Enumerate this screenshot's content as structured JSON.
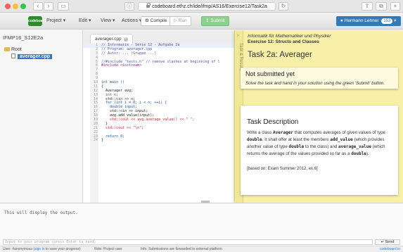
{
  "browser": {
    "url": "codeboard.ethz.ch/ide/ifmp/AS16/Exercise12/Task2a",
    "buttons": {
      "back": "‹",
      "forward": "›",
      "sidebar": "▭",
      "info": "ⓘ",
      "reload": "↻",
      "share": "⇧",
      "tabs": "⧉",
      "new_tab": "+"
    }
  },
  "navbar": {
    "logo_text": "codeboard",
    "project": "Project",
    "edit": "Edit",
    "view": "View",
    "actions": "Actions",
    "compile": "Compile",
    "run": "Run",
    "submit": "Submit",
    "user_name": "Hermann Lehner",
    "user_badge": "153"
  },
  "sidebar": {
    "project_name": "IFMP16_S12E2a",
    "root_label": "Root",
    "file_label": "averager.cpp"
  },
  "editor": {
    "tab_label": "averager.cpp",
    "lines": [
      {
        "n": "1",
        "t": "// Informatik - Serie 12 - Aufgabe 2a",
        "c": "comment",
        "hl": true
      },
      {
        "n": "2",
        "t": "// Program: averager.cpp",
        "c": "comment",
        "hl": false
      },
      {
        "n": "3",
        "t": "// Autor: ... (Gruppe ...)",
        "c": "comment",
        "hl": false
      },
      {
        "n": "4",
        "t": "",
        "c": "plain",
        "hl": false
      },
      {
        "n": "5",
        "t": "//#include \"tests.h\" // remove slashes at beginning of l",
        "c": "comment",
        "hl": false
      },
      {
        "n": "6",
        "t": "#include <iostream>",
        "c": "pre",
        "hl": false
      },
      {
        "n": "7",
        "t": "",
        "c": "plain",
        "hl": false
      },
      {
        "n": "8",
        "t": "",
        "c": "plain",
        "hl": false
      },
      {
        "n": "9",
        "t": "",
        "c": "plain",
        "hl": false
      },
      {
        "n": "10",
        "t": "int main ()",
        "c": "kw",
        "hl": false
      },
      {
        "n": "11",
        "t": "{",
        "c": "plain",
        "hl": false
      },
      {
        "n": "12",
        "t": "  Averager avg;",
        "c": "plain",
        "hl": false
      },
      {
        "n": "13",
        "t": "  int n;",
        "c": "kw",
        "hl": false
      },
      {
        "n": "14",
        "t": "  std::cin >> n;",
        "c": "plain",
        "hl": false
      },
      {
        "n": "15",
        "t": "  for (int i = 0; i < n; ++i) {",
        "c": "kw",
        "hl": false
      },
      {
        "n": "16",
        "t": "    double input;",
        "c": "kw",
        "hl": false
      },
      {
        "n": "17",
        "t": "    std::cin >> input;",
        "c": "plain",
        "hl": false
      },
      {
        "n": "18",
        "t": "    avg.add_value(input);",
        "c": "plain",
        "hl": false
      },
      {
        "n": "19",
        "t": "    std::cout << avg.average_value() << \" \";",
        "c": "str",
        "hl": false
      },
      {
        "n": "20",
        "t": "  }",
        "c": "plain",
        "hl": false
      },
      {
        "n": "21",
        "t": "  std::cout << \"\\n\";",
        "c": "str",
        "hl": false
      },
      {
        "n": "22",
        "t": "",
        "c": "plain",
        "hl": false
      },
      {
        "n": "23",
        "t": "  return 0;",
        "c": "kw",
        "hl": false
      },
      {
        "n": "24",
        "t": "}",
        "c": "plain",
        "hl": false
      }
    ]
  },
  "task": {
    "side_label": "Task & Results",
    "course": "Informatik für Mathematiker und Physiker",
    "exercise": "Exercise 12: Structs and Classes",
    "title": "Task 2a: Averager",
    "status_title": "Not submitted yet",
    "status_text": "Solve the task and hand in your solution using the green 'Submit' button.",
    "desc_title": "Task Description",
    "desc_parts": [
      {
        "t": "Write a class ",
        "code": false
      },
      {
        "t": "Averager",
        "code": true
      },
      {
        "t": " that computes averages of given values of type ",
        "code": false
      },
      {
        "t": "double",
        "code": true
      },
      {
        "t": ". It shall offer at least the members ",
        "code": false
      },
      {
        "t": "add_value",
        "code": true
      },
      {
        "t": " (which provides another value of type ",
        "code": false
      },
      {
        "t": "double",
        "code": true
      },
      {
        "t": " to the class) and ",
        "code": false
      },
      {
        "t": "average_value",
        "code": true
      },
      {
        "t": " (which returns the average of the values provided so far as a ",
        "code": false
      },
      {
        "t": "double",
        "code": true
      },
      {
        "t": ").",
        "code": false
      }
    ],
    "desc_source": "[based on: Exam Summer 2012, ex.6]"
  },
  "output": {
    "text": "This will display the output.",
    "input_placeholder": "Input to your program (press Enter to send)",
    "send_label": "Send"
  },
  "statusbar": {
    "user_prefix": "User: #anonymous (",
    "login_link": "sign in",
    "user_suffix": " to save your progress)",
    "role": "Role: Project user",
    "info": "Info: Submissions are forwarded to external platform",
    "brand": "codeboard.io"
  },
  "colors": {
    "accent": "#337ab7",
    "submit": "#8fd08f",
    "task_bg": "#f8f0a8"
  }
}
